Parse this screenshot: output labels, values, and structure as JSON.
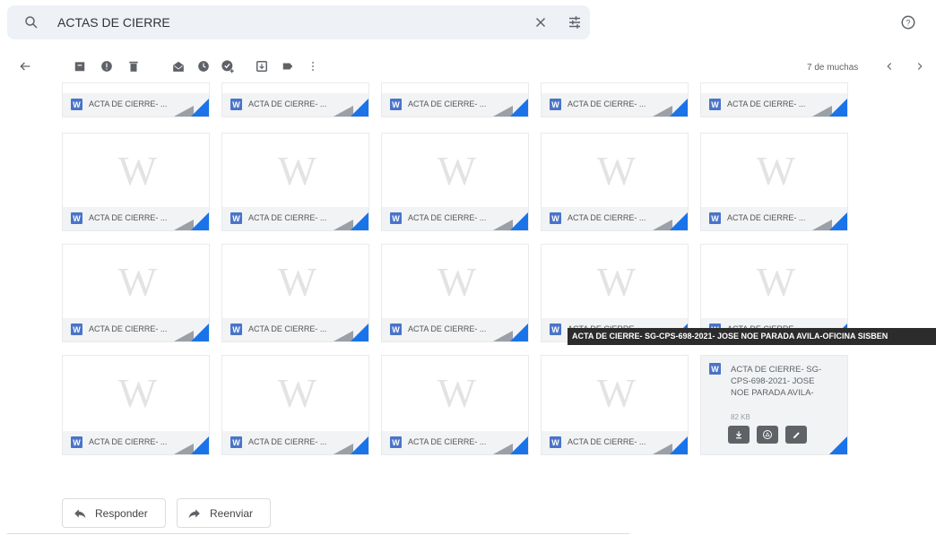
{
  "search": {
    "query": "ACTAS DE CIERRE"
  },
  "toolbar": {
    "page_count": "7 de muchas"
  },
  "attachments": {
    "short_name": "ACTA DE CIERRE- ...",
    "hovered_name": "ACTA DE CIERRE- SG-CPS-698-2021- JOSE NOE PARADA AVILA-",
    "hovered_size": "82 KB",
    "tooltip": "ACTA DE CIERRE- SG-CPS-698-2021- JOSE NOE PARADA AVILA-OFICINA SISBEN"
  },
  "actions": {
    "reply": "Responder",
    "forward": "Reenviar"
  },
  "icons": [
    "search-icon",
    "clear-icon",
    "tune-icon",
    "help-icon",
    "back-icon",
    "archive-icon",
    "report-spam-icon",
    "delete-icon",
    "mark-unread-icon",
    "snooze-icon",
    "add-task-icon",
    "move-to-icon",
    "label-icon",
    "more-icon",
    "prev-icon",
    "next-icon",
    "word-icon",
    "download-icon",
    "drive-icon",
    "edit-icon",
    "reply-icon",
    "forward-icon"
  ],
  "colors": {
    "accent": "#1a73e8",
    "word": "#4a74c9",
    "search_bg": "#eef2f7"
  }
}
